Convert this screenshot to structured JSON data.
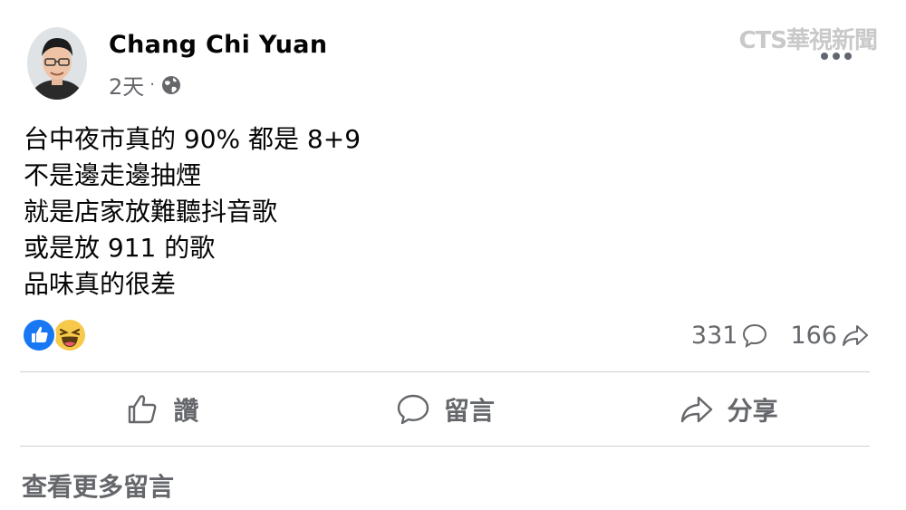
{
  "post": {
    "author": "Chang Chi Yuan",
    "time": "2天",
    "separator": "·",
    "privacy_icon": "globe-icon",
    "more_icon": "more-options-icon"
  },
  "watermark": "CTS華視新聞",
  "content_lines": [
    "台中夜市真的 90% 都是 8+9",
    "不是邊走邊抽煙",
    "就是店家放難聽抖音歌",
    "或是放 911 的歌",
    "品味真的很差"
  ],
  "reactions": {
    "icons": [
      "like-reaction-icon",
      "haha-reaction-icon"
    ]
  },
  "counts": {
    "comments": "331",
    "shares": "166"
  },
  "actions": {
    "like": "讚",
    "comment": "留言",
    "share": "分享"
  },
  "footer": {
    "view_more": "查看更多留言"
  },
  "colors": {
    "secondary_text": "#65676b",
    "like_blue": "#1877f2",
    "haha_yellow": "#f7c94b",
    "divider": "#ced0d4"
  }
}
